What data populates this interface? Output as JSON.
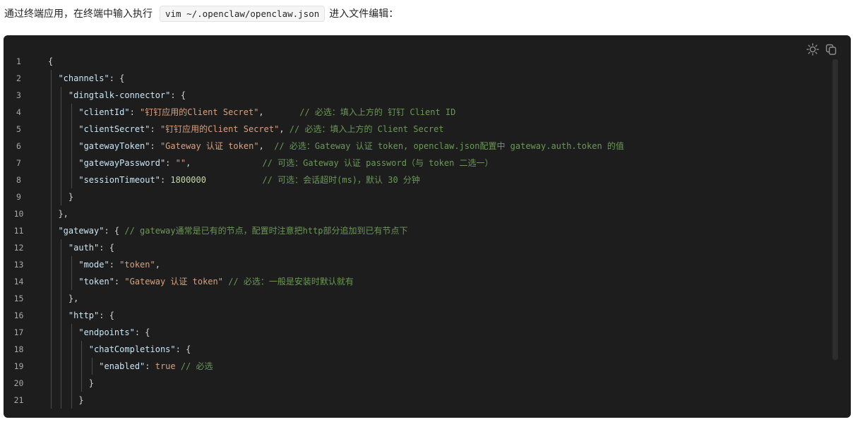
{
  "intro": {
    "prefix": "通过终端应用，在终端中输入执行",
    "command": "vim ~/.openclaw/openclaw.json",
    "suffix": "进入文件编辑："
  },
  "toolbar": {
    "icons": [
      "theme-toggle-icon",
      "copy-icon"
    ]
  },
  "colors": {
    "background": "#1d1d1d",
    "key": "#c9e6f5",
    "string": "#d9a07d",
    "comment": "#6a9955",
    "number": "#c5d9a8"
  },
  "code": {
    "lines": [
      {
        "n": "1",
        "indent": 0,
        "tokens": [
          {
            "t": "{",
            "c": "pun"
          }
        ]
      },
      {
        "n": "2",
        "indent": 1,
        "tokens": [
          {
            "t": "\"channels\"",
            "c": "key"
          },
          {
            "t": ": {",
            "c": "pun"
          }
        ]
      },
      {
        "n": "3",
        "indent": 2,
        "tokens": [
          {
            "t": "\"dingtalk-connector\"",
            "c": "key"
          },
          {
            "t": ": {",
            "c": "pun"
          }
        ]
      },
      {
        "n": "4",
        "indent": 3,
        "tokens": [
          {
            "t": "\"clientId\"",
            "c": "key"
          },
          {
            "t": ": ",
            "c": "pun"
          },
          {
            "t": "\"钉钉应用的Client Secret\"",
            "c": "str"
          },
          {
            "t": ",       ",
            "c": "pun"
          },
          {
            "t": "// 必选：填入上方的 钉钉 Client ID",
            "c": "com"
          }
        ]
      },
      {
        "n": "5",
        "indent": 3,
        "tokens": [
          {
            "t": "\"clientSecret\"",
            "c": "key"
          },
          {
            "t": ": ",
            "c": "pun"
          },
          {
            "t": "\"钉钉应用的Client Secret\"",
            "c": "str"
          },
          {
            "t": ", ",
            "c": "pun"
          },
          {
            "t": "// 必选：填入上方的 Client Secret",
            "c": "com"
          }
        ]
      },
      {
        "n": "6",
        "indent": 3,
        "tokens": [
          {
            "t": "\"gatewayToken\"",
            "c": "key"
          },
          {
            "t": ": ",
            "c": "pun"
          },
          {
            "t": "\"Gateway 认证 token\"",
            "c": "str"
          },
          {
            "t": ",  ",
            "c": "pun"
          },
          {
            "t": "// 必选：Gateway 认证 token, openclaw.json配置中 gateway.auth.token 的值",
            "c": "com"
          }
        ]
      },
      {
        "n": "7",
        "indent": 3,
        "tokens": [
          {
            "t": "\"gatewayPassword\"",
            "c": "key"
          },
          {
            "t": ": ",
            "c": "pun"
          },
          {
            "t": "\"\"",
            "c": "str"
          },
          {
            "t": ",              ",
            "c": "pun"
          },
          {
            "t": "// 可选：Gateway 认证 password（与 token 二选一）",
            "c": "com"
          }
        ]
      },
      {
        "n": "8",
        "indent": 3,
        "tokens": [
          {
            "t": "\"sessionTimeout\"",
            "c": "key"
          },
          {
            "t": ": ",
            "c": "pun"
          },
          {
            "t": "1800000",
            "c": "num"
          },
          {
            "t": "           ",
            "c": "pun"
          },
          {
            "t": "// 可选：会话超时(ms)，默认 30 分钟",
            "c": "com"
          }
        ]
      },
      {
        "n": "9",
        "indent": 2,
        "tokens": [
          {
            "t": "}",
            "c": "pun"
          }
        ]
      },
      {
        "n": "10",
        "indent": 1,
        "tokens": [
          {
            "t": "},",
            "c": "pun"
          }
        ]
      },
      {
        "n": "11",
        "indent": 1,
        "tokens": [
          {
            "t": "\"gateway\"",
            "c": "key"
          },
          {
            "t": ": { ",
            "c": "pun"
          },
          {
            "t": "// gateway通常是已有的节点，配置时注意把http部分追加到已有节点下",
            "c": "com"
          }
        ]
      },
      {
        "n": "12",
        "indent": 2,
        "tokens": [
          {
            "t": "\"auth\"",
            "c": "key"
          },
          {
            "t": ": {",
            "c": "pun"
          }
        ]
      },
      {
        "n": "13",
        "indent": 3,
        "tokens": [
          {
            "t": "\"mode\"",
            "c": "key"
          },
          {
            "t": ": ",
            "c": "pun"
          },
          {
            "t": "\"token\"",
            "c": "str"
          },
          {
            "t": ",",
            "c": "pun"
          }
        ]
      },
      {
        "n": "14",
        "indent": 3,
        "tokens": [
          {
            "t": "\"token\"",
            "c": "key"
          },
          {
            "t": ": ",
            "c": "pun"
          },
          {
            "t": "\"Gateway 认证 token\"",
            "c": "str"
          },
          {
            "t": " ",
            "c": "pun"
          },
          {
            "t": "// 必选：一般是安装时默认就有",
            "c": "com"
          }
        ]
      },
      {
        "n": "15",
        "indent": 2,
        "tokens": [
          {
            "t": "},",
            "c": "pun"
          }
        ]
      },
      {
        "n": "16",
        "indent": 2,
        "tokens": [
          {
            "t": "\"http\"",
            "c": "key"
          },
          {
            "t": ": {",
            "c": "pun"
          }
        ]
      },
      {
        "n": "17",
        "indent": 3,
        "tokens": [
          {
            "t": "\"endpoints\"",
            "c": "key"
          },
          {
            "t": ": {",
            "c": "pun"
          }
        ]
      },
      {
        "n": "18",
        "indent": 4,
        "tokens": [
          {
            "t": "\"chatCompletions\"",
            "c": "key"
          },
          {
            "t": ": {",
            "c": "pun"
          }
        ]
      },
      {
        "n": "19",
        "indent": 5,
        "tokens": [
          {
            "t": "\"enabled\"",
            "c": "key"
          },
          {
            "t": ": ",
            "c": "pun"
          },
          {
            "t": "true",
            "c": "kw"
          },
          {
            "t": " ",
            "c": "pun"
          },
          {
            "t": "// 必选",
            "c": "com"
          }
        ]
      },
      {
        "n": "20",
        "indent": 4,
        "tokens": [
          {
            "t": "}",
            "c": "pun"
          }
        ]
      },
      {
        "n": "21",
        "indent": 3,
        "tokens": [
          {
            "t": "}",
            "c": "pun"
          }
        ]
      }
    ]
  }
}
